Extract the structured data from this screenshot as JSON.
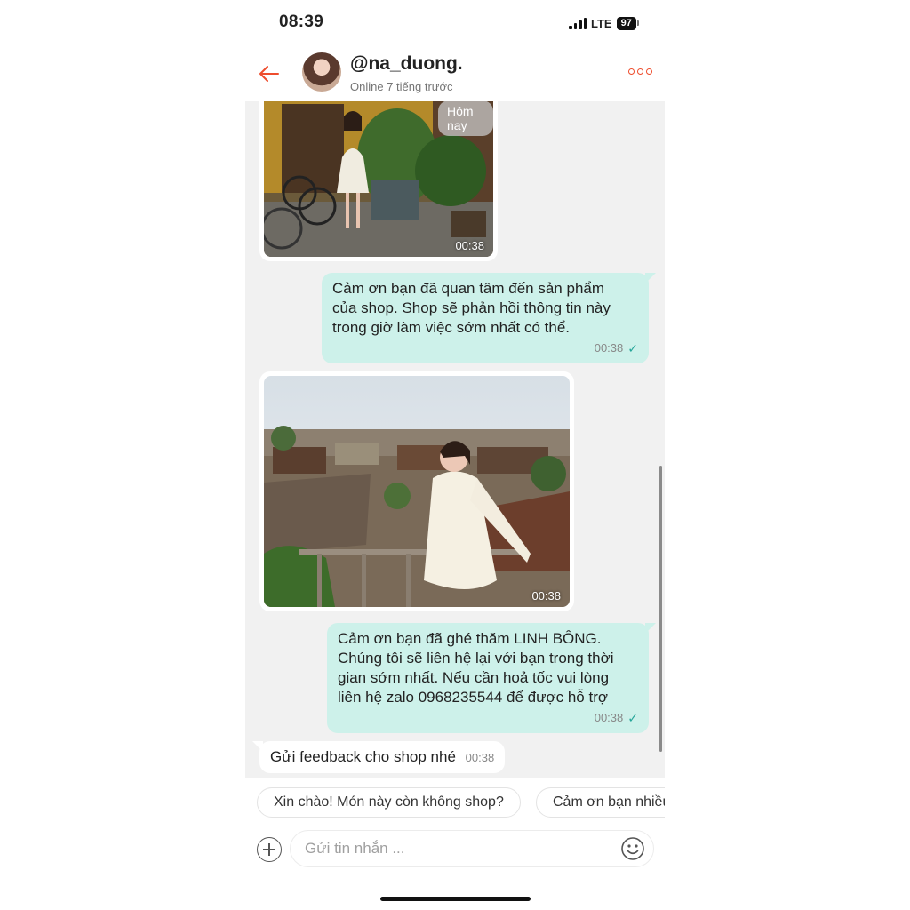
{
  "status_bar": {
    "time": "08:39",
    "network": "LTE",
    "battery": "97"
  },
  "header": {
    "username": "@na_duong.",
    "status": "Online 7 tiếng trước"
  },
  "chat": {
    "date_chip": "Hôm nay",
    "messages": [
      {
        "type": "image",
        "direction": "incoming",
        "time": "00:38"
      },
      {
        "type": "text",
        "direction": "outgoing",
        "lines": [
          "Cảm ơn bạn đã quan tâm đến sản phẩm",
          "của shop. Shop sẽ phản hồi thông tin này",
          "trong giờ làm việc sớm nhất có thể."
        ],
        "time": "00:38",
        "read_icon": "check-icon"
      },
      {
        "type": "image",
        "direction": "incoming",
        "time": "00:38"
      },
      {
        "type": "text",
        "direction": "outgoing",
        "lines": [
          "Cảm ơn bạn đã ghé thăm LINH BÔNG.",
          "Chúng tôi sẽ liên hệ lại với bạn trong thời",
          "gian sớm nhất. Nếu cần hoả tốc vui lòng",
          "liên hệ zalo 0968235544 để được hỗ trợ"
        ],
        "time": "00:38",
        "read_icon": "check-icon"
      },
      {
        "type": "text",
        "direction": "incoming",
        "text": "Gửi feedback cho shop nhé",
        "time": "00:38"
      }
    ]
  },
  "quick_replies": [
    "Xin chào! Món này còn không shop?",
    "Cảm ơn bạn nhiều"
  ],
  "composer": {
    "placeholder": "Gửi tin nhắn ..."
  },
  "colors": {
    "accent": "#ee4d2d",
    "outgoing_bubble": "#cdf1ea",
    "chat_bg": "#f1f1f1",
    "read_check": "#26a69a"
  }
}
